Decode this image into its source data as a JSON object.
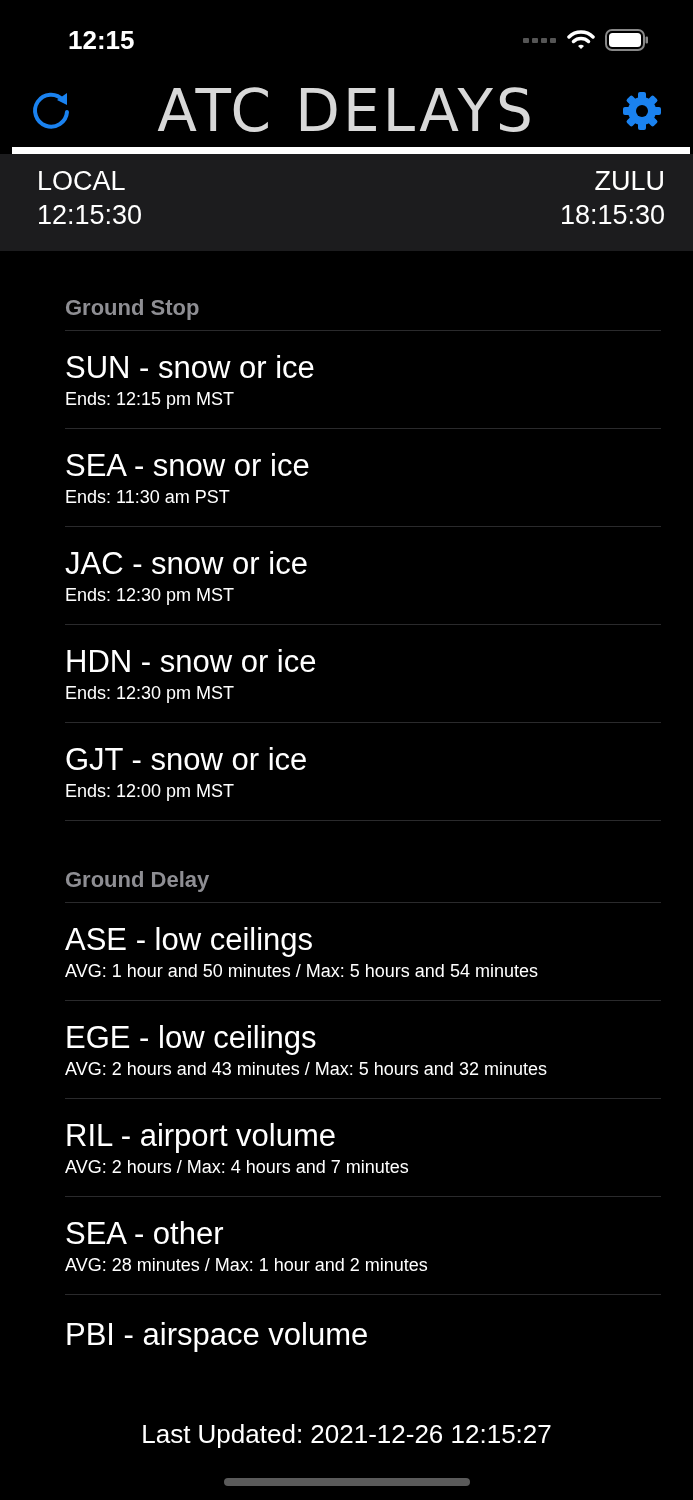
{
  "status_bar": {
    "time": "12:15"
  },
  "app_title": "ATC DELAYS",
  "clocks": [
    {
      "label": "LOCAL",
      "time": "12:15:30"
    },
    {
      "label": "ZULU",
      "time": "18:15:30"
    }
  ],
  "sections": [
    {
      "header": "Ground Stop",
      "items": [
        {
          "title": "SUN - snow or ice",
          "detail": "Ends: 12:15 pm MST"
        },
        {
          "title": "SEA - snow or ice",
          "detail": "Ends: 11:30 am PST"
        },
        {
          "title": "JAC - snow or ice",
          "detail": "Ends: 12:30 pm MST"
        },
        {
          "title": "HDN - snow or ice",
          "detail": "Ends: 12:30 pm MST"
        },
        {
          "title": "GJT - snow or ice",
          "detail": "Ends: 12:00 pm MST"
        }
      ]
    },
    {
      "header": "Ground Delay",
      "items": [
        {
          "title": "ASE - low ceilings",
          "detail": "AVG: 1 hour and 50 minutes / Max: 5 hours and 54 minutes"
        },
        {
          "title": "EGE - low ceilings",
          "detail": "AVG: 2 hours and 43 minutes / Max: 5 hours and 32 minutes"
        },
        {
          "title": "RIL - airport volume",
          "detail": "AVG: 2 hours / Max: 4 hours and 7 minutes"
        },
        {
          "title": "SEA - other",
          "detail": "AVG: 28 minutes / Max: 1 hour and 2 minutes"
        },
        {
          "title": "PBI - airspace volume"
        }
      ]
    }
  ],
  "last_updated": "Last Updated: 2021-12-26 12:15:27"
}
